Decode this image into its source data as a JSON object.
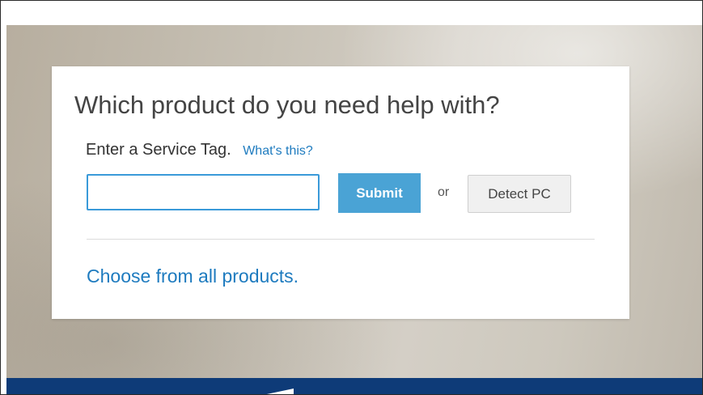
{
  "support": {
    "title": "Which product do you need help with?",
    "service_tag_label": "Enter a Service Tag.",
    "whats_this_link": "What's this?",
    "service_tag_input": {
      "value": "",
      "placeholder": ""
    },
    "submit_label": "Submit",
    "or_label": "or",
    "detect_pc_label": "Detect PC",
    "choose_products_link": "Choose from all products."
  },
  "colors": {
    "link": "#1e7bbf",
    "submit_button": "#4aa3d5",
    "input_border": "#3a9ad9",
    "footer_bar": "#0e3b78"
  }
}
